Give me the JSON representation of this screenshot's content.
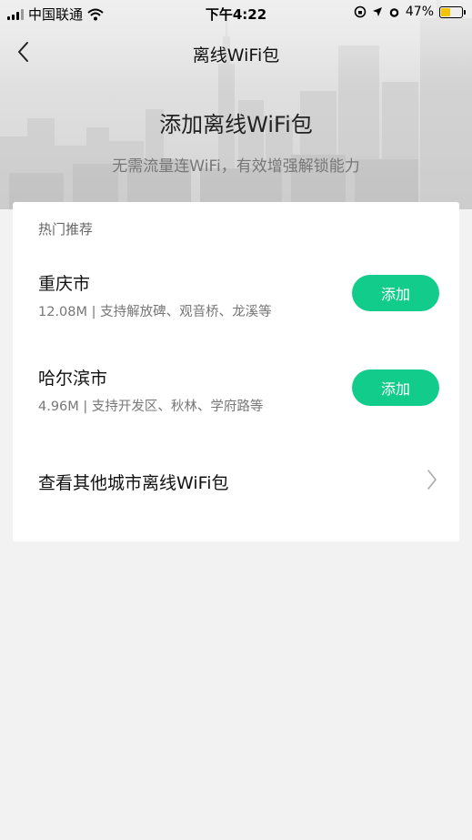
{
  "status_bar": {
    "carrier": "中国联通",
    "time": "下午4:22",
    "battery": "47%",
    "battery_level": 0.47
  },
  "nav": {
    "title": "离线WiFi包",
    "back_icon": "chevron-left-icon"
  },
  "hero": {
    "title": "添加离线WiFi包",
    "subtitle": "无需流量连WiFi，有效增强解锁能力"
  },
  "recommend": {
    "label": "热门推荐",
    "cities": [
      {
        "name": "重庆市",
        "desc": "12.08M | 支持解放碑、观音桥、龙溪等",
        "button": "添加"
      },
      {
        "name": "哈尔滨市",
        "desc": "4.96M | 支持开发区、秋林、学府路等",
        "button": "添加"
      }
    ]
  },
  "more_link": {
    "label": "查看其他城市离线WiFi包",
    "icon": "chevron-right-icon"
  },
  "colors": {
    "accent": "#11cc8a",
    "background": "#f2f2f2",
    "card": "#ffffff"
  }
}
